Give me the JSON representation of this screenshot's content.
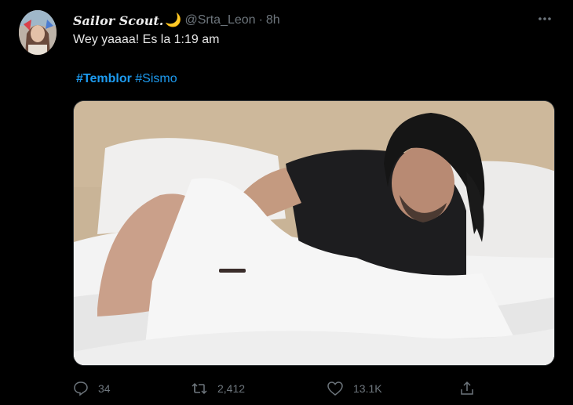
{
  "tweet": {
    "display_name": "Sailor Scout.",
    "name_emoji": "🌙",
    "handle": "@Srta_Leon",
    "separator": "·",
    "timestamp": "8h",
    "text": "Wey yaaaa! Es la 1:19 am",
    "hashtags": [
      {
        "label": "#Temblor"
      },
      {
        "label": "#Sismo"
      }
    ],
    "media_description_icon": "photo-media",
    "stats": {
      "replies": "34",
      "retweets": "2,412",
      "likes": "13.1K"
    }
  },
  "icons": {
    "more": "more-horizontal-icon",
    "reply": "reply-icon",
    "retweet": "retweet-icon",
    "like": "heart-icon",
    "share": "share-icon"
  },
  "colors": {
    "background": "#000000",
    "link": "#1d9bf0",
    "secondary_text": "#6e767d",
    "primary_text": "#e7e7e7"
  }
}
